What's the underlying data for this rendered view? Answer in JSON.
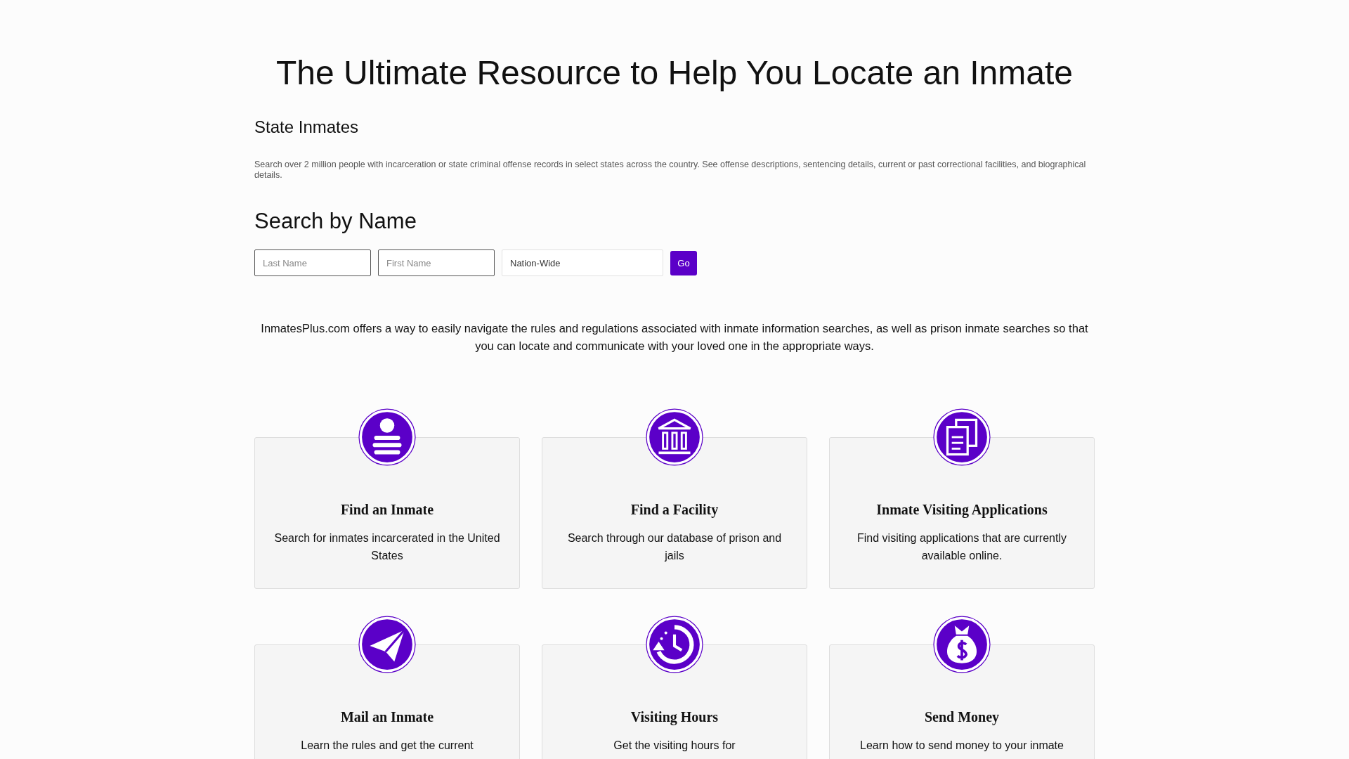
{
  "title": "The Ultimate Resource to Help You Locate an Inmate",
  "state_section": {
    "heading": "State Inmates",
    "description": "Search over 2 million people with incarceration or state criminal offense records in select states across the country. See offense descriptions, sentencing details, current or past correctional facilities, and biographical details."
  },
  "search": {
    "heading": "Search by Name",
    "fields": [
      {
        "placeholder": "Last Name"
      },
      {
        "placeholder": "First Name"
      },
      {
        "value": "Nation-Wide"
      }
    ],
    "button": "Go"
  },
  "intro": "InmatesPlus.com offers a way to easily navigate the rules and regulations associated with inmate information searches, as well as prison inmate searches so that you can locate and communicate with your loved one in the appropriate ways.",
  "cards": [
    {
      "kind": "person",
      "title": "Find an Inmate",
      "description": "Search for inmates incarcerated in the United States"
    },
    {
      "kind": "building",
      "title": "Find a Facility",
      "description": "Search through our database of prison and jails"
    },
    {
      "kind": "documents",
      "title": "Inmate Visiting Applications",
      "description": "Find visiting applications that are currently available online."
    },
    {
      "kind": "plane",
      "title": "Mail an Inmate",
      "description": "Learn the rules and get the current"
    },
    {
      "kind": "clock",
      "title": "Visiting Hours",
      "description": "Get the visiting hours for"
    },
    {
      "kind": "moneybag",
      "title": "Send Money",
      "description": "Learn how to send money to your inmate"
    }
  ]
}
